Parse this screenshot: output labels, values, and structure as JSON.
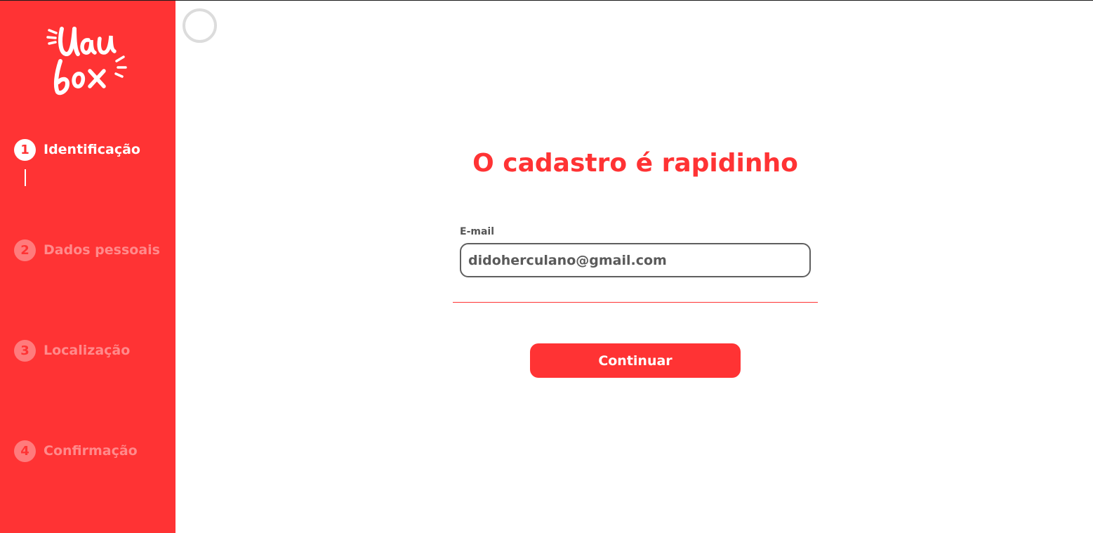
{
  "brand": {
    "logo_text_line1": "Uau",
    "logo_text_line2": "box",
    "color": "#ff3334"
  },
  "steps": [
    {
      "number": "1",
      "label": "Identificação",
      "state": "active"
    },
    {
      "number": "2",
      "label": "Dados pessoais",
      "state": "inactive"
    },
    {
      "number": "3",
      "label": "Localização",
      "state": "inactive"
    },
    {
      "number": "4",
      "label": "Confirmação",
      "state": "inactive"
    }
  ],
  "main": {
    "title": "O cadastro é rapidinho",
    "email_label": "E-mail",
    "email_value": "didoherculano@gmail.com",
    "continue_label": "Continuar"
  },
  "colors": {
    "accent": "#ff3334",
    "step_inactive_text": "#ff8a8b",
    "input_border": "#5f5f5f"
  },
  "icons": {
    "loading": "loading-spinner-icon"
  }
}
